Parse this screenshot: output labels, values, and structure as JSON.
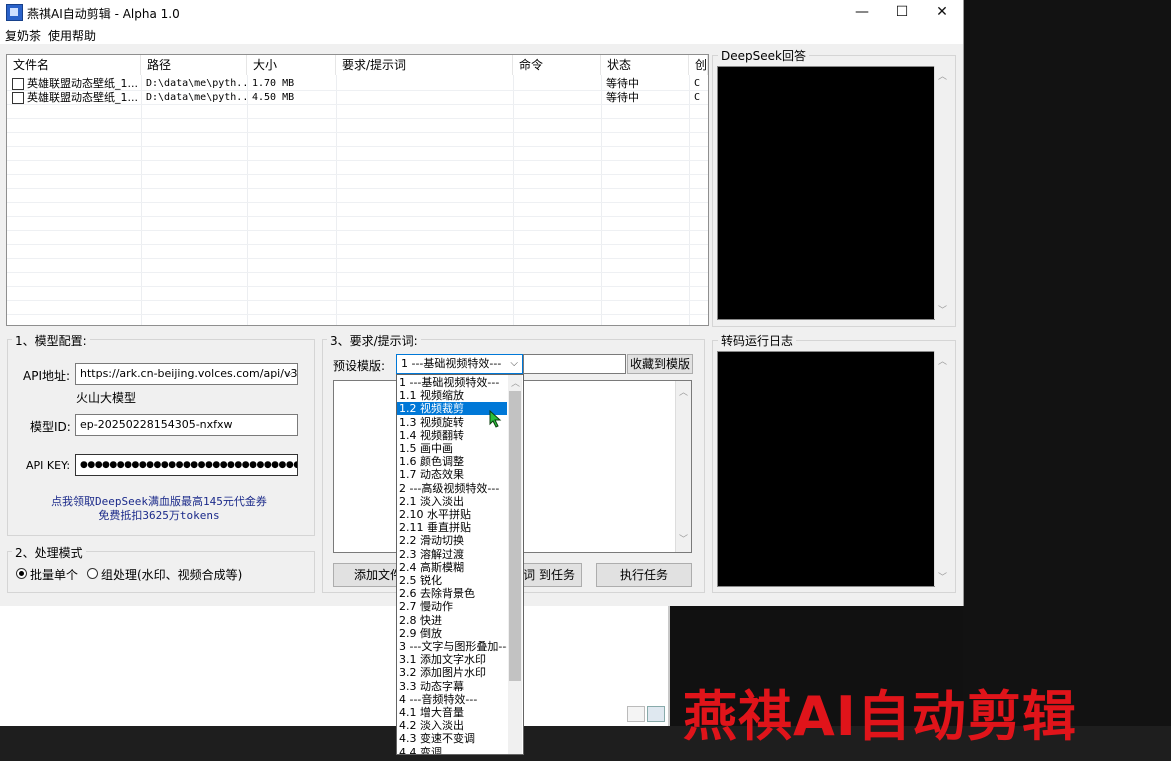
{
  "window": {
    "title": "燕祺AI自动剪辑 - Alpha 1.0",
    "controls": [
      "—",
      "☐",
      "✕"
    ]
  },
  "menubar": [
    "复奶茶",
    "使用帮助"
  ],
  "file_table": {
    "columns": [
      "文件名",
      "路径",
      "大小",
      "要求/提示词",
      "命令",
      "状态",
      "创"
    ],
    "rows": [
      {
        "name": "英雄联盟动态壁纸_1...",
        "path": "D:\\data\\me\\pyth...",
        "size": "1.70 MB",
        "prompt": "",
        "command": "",
        "status": "等待中",
        "extra": "C"
      },
      {
        "name": "英雄联盟动态壁纸_1...",
        "path": "D:\\data\\me\\pyth...",
        "size": "4.50 MB",
        "prompt": "",
        "command": "",
        "status": "等待中",
        "extra": "C"
      }
    ]
  },
  "model_config": {
    "group_title": "1、模型配置:",
    "api_label": "API地址:",
    "api_value": "https://ark.cn-beijing.volces.com/api/v3",
    "provider": "火山大模型",
    "model_id_label": "模型ID:",
    "model_id_value": "ep-20250228154305-nxfxw",
    "api_key_label": "API KEY:",
    "api_key_value": "●●●●●●●●●●●●●●●●●●●●●●●●●●●●●●●●●●●",
    "promo_line1": "点我领取DeepSeek满血版最高145元代金券",
    "promo_line2": "免费抵扣3625万tokens"
  },
  "processing_mode": {
    "group_title": "2、处理模式",
    "option1": "批量单个",
    "option2": "组处理(水印、视频合成等)",
    "selected": "批量单个"
  },
  "prompt_section": {
    "group_title": "3、要求/提示词:",
    "preset_label": "预设模版:",
    "preset_selected": "1 ---基础视频特效---",
    "favorite_button": "收藏到模版",
    "add_button": "添加文件",
    "apply_button": "词 到任务",
    "run_button": "执行任务"
  },
  "deepseek_panel": {
    "title": "DeepSeek回答"
  },
  "log_panel": {
    "title": "转码运行日志"
  },
  "dropdown_items": [
    "1 ---基础视频特效---",
    "1.1 视频缩放",
    "1.2 视频裁剪",
    "1.3 视频旋转",
    "1.4 视频翻转",
    "1.5 画中画",
    "1.6 颜色调整",
    "1.7 动态效果",
    "2 ---高级视频特效---",
    "2.1 淡入淡出",
    "2.10 水平拼贴",
    "2.11 垂直拼贴",
    "2.2 滑动切换",
    "2.3 溶解过渡",
    "2.4 高斯模糊",
    "2.5 锐化",
    "2.6 去除背景色",
    "2.7 慢动作",
    "2.8 快进",
    "2.9 倒放",
    "3 ---文字与图形叠加---",
    "3.1 添加文字水印",
    "3.2 添加图片水印",
    "3.3 动态字幕",
    "4 ---音频特效---",
    "4.1 增大音量",
    "4.2 淡入淡出",
    "4.3 变速不变调",
    "4.4 变调"
  ],
  "dropdown_selected_index": 2,
  "watermark": "燕祺AI自动剪辑",
  "colors": {
    "selection": "#0078d7",
    "watermark": "#e0141a",
    "link": "#1b2a8a"
  }
}
